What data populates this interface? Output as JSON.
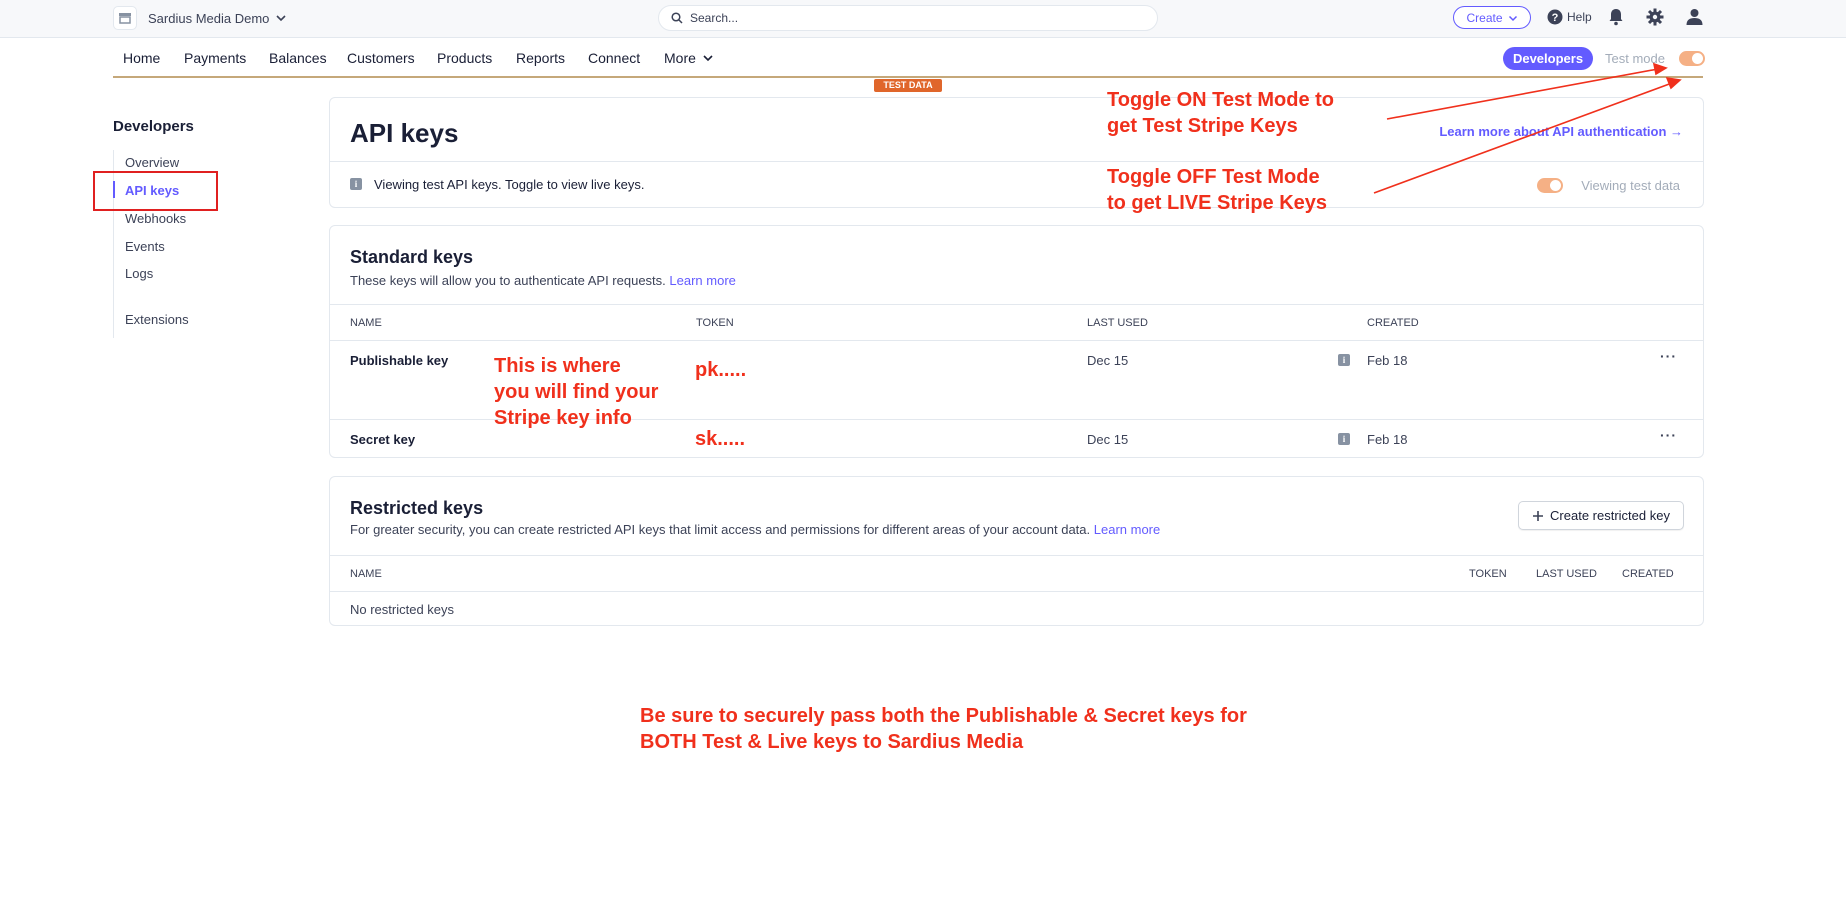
{
  "topbar": {
    "account_name": "Sardius Media Demo",
    "search_placeholder": "Search...",
    "create_label": "Create",
    "help_label": "Help"
  },
  "nav": {
    "items": [
      "Home",
      "Payments",
      "Balances",
      "Customers",
      "Products",
      "Reports",
      "Connect",
      "More"
    ],
    "developers_label": "Developers",
    "test_mode_label": "Test mode",
    "test_data_badge": "TEST DATA"
  },
  "sidebar": {
    "title": "Developers",
    "items": [
      "Overview",
      "API keys",
      "Webhooks",
      "Events",
      "Logs",
      "Extensions"
    ],
    "active": "API keys"
  },
  "api_card": {
    "title": "API keys",
    "learn_more": "Learn more about API authentication →",
    "info_text": "Viewing test API keys. Toggle to view live keys.",
    "viewing_label": "Viewing test data"
  },
  "standard_keys": {
    "title": "Standard keys",
    "description": "These keys will allow you to authenticate API requests.",
    "learn_more": "Learn more",
    "columns": [
      "NAME",
      "TOKEN",
      "LAST USED",
      "CREATED"
    ],
    "rows": [
      {
        "name": "Publishable key",
        "token": "pk.....",
        "last_used": "Dec 15",
        "created": "Feb 18"
      },
      {
        "name": "Secret key",
        "token": "sk.....",
        "last_used": "Dec 15",
        "created": "Feb 18"
      }
    ]
  },
  "restricted_keys": {
    "title": "Restricted keys",
    "description": "For greater security, you can create restricted API keys that limit access and permissions for different areas of your account data.",
    "learn_more": "Learn more",
    "create_label": "Create restricted key",
    "columns": [
      "NAME",
      "TOKEN",
      "LAST USED",
      "CREATED"
    ],
    "empty_text": "No restricted keys"
  },
  "annotations": {
    "toggle_on": [
      "Toggle ON Test Mode to",
      "get Test Stripe Keys"
    ],
    "toggle_off": [
      "Toggle OFF Test Mode",
      "to get LIVE Stripe Keys"
    ],
    "find_keys": [
      "This is where",
      "you will find your",
      "Stripe key info"
    ],
    "footer": [
      "Be sure to securely pass both the Publishable & Secret keys for",
      "BOTH Test & Live keys to Sardius Media"
    ]
  },
  "colors": {
    "brand": "#635bff",
    "annotation": "#f0301c",
    "test_badge": "#e0662b",
    "toggle": "#f5b085"
  }
}
